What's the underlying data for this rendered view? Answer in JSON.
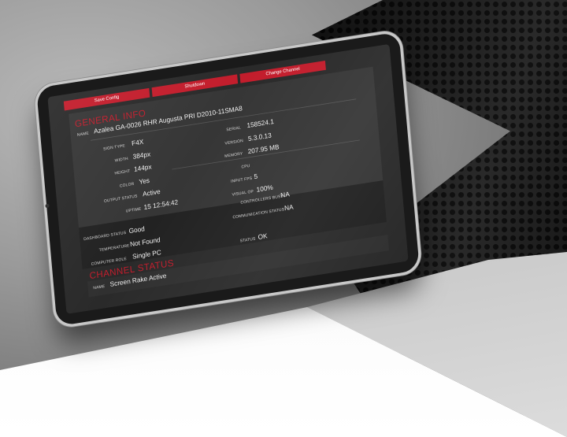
{
  "tabs": [
    "Save Config",
    "Shutdown",
    "Change Channel"
  ],
  "general": {
    "title": "GENERAL INFO",
    "name_label": "NAME",
    "name_value": "Azalea GA-0026 RHR Augusta PRI D2010-11SMA8",
    "sign_type_label": "SIGN TYPE",
    "sign_type_value": "F4X",
    "width_label": "WIDTH",
    "width_value": "384px",
    "height_label": "HEIGHT",
    "height_value": "144px",
    "color_label": "COLOR",
    "color_value": "Yes",
    "output_status_label": "OUTPUT STATUS",
    "output_status_value": "Active",
    "uptime_label": "UPTIME",
    "uptime_value": "15 12:54:42",
    "serial_label": "SERIAL",
    "serial_value": "158524.1",
    "version_label": "VERSION",
    "version_value": "5.3.0.13",
    "memory_label": "MEMORY",
    "memory_value": "207.95 MB",
    "cpu_label": "CPU",
    "input_fps_label": "INPUT FPS",
    "input_fps_value": "5",
    "visual_op_label": "VISUAL OP",
    "visual_op_value": "100%",
    "dashboard_status_label": "DASHBOARD STATUS",
    "dashboard_status_value": "Good",
    "temperature_label": "TEMPERATURE",
    "temperature_value": "Not Found",
    "computer_role_label": "COMPUTER ROLE",
    "computer_role_value": "Single PC",
    "controllers_busy_label": "CONTROLLERS BUSY",
    "controllers_busy_value": "NA",
    "communication_status_label": "COMMUNICATION STATUS",
    "communication_status_value": "NA",
    "status_label": "STATUS",
    "status_value": "OK"
  },
  "channel": {
    "title": "CHANNEL STATUS",
    "name_label": "NAME",
    "name_value": "Screen Rake Active"
  },
  "colors": {
    "accent": "#c31d2c",
    "panel": "#363636",
    "screen": "#2a2a2a"
  }
}
